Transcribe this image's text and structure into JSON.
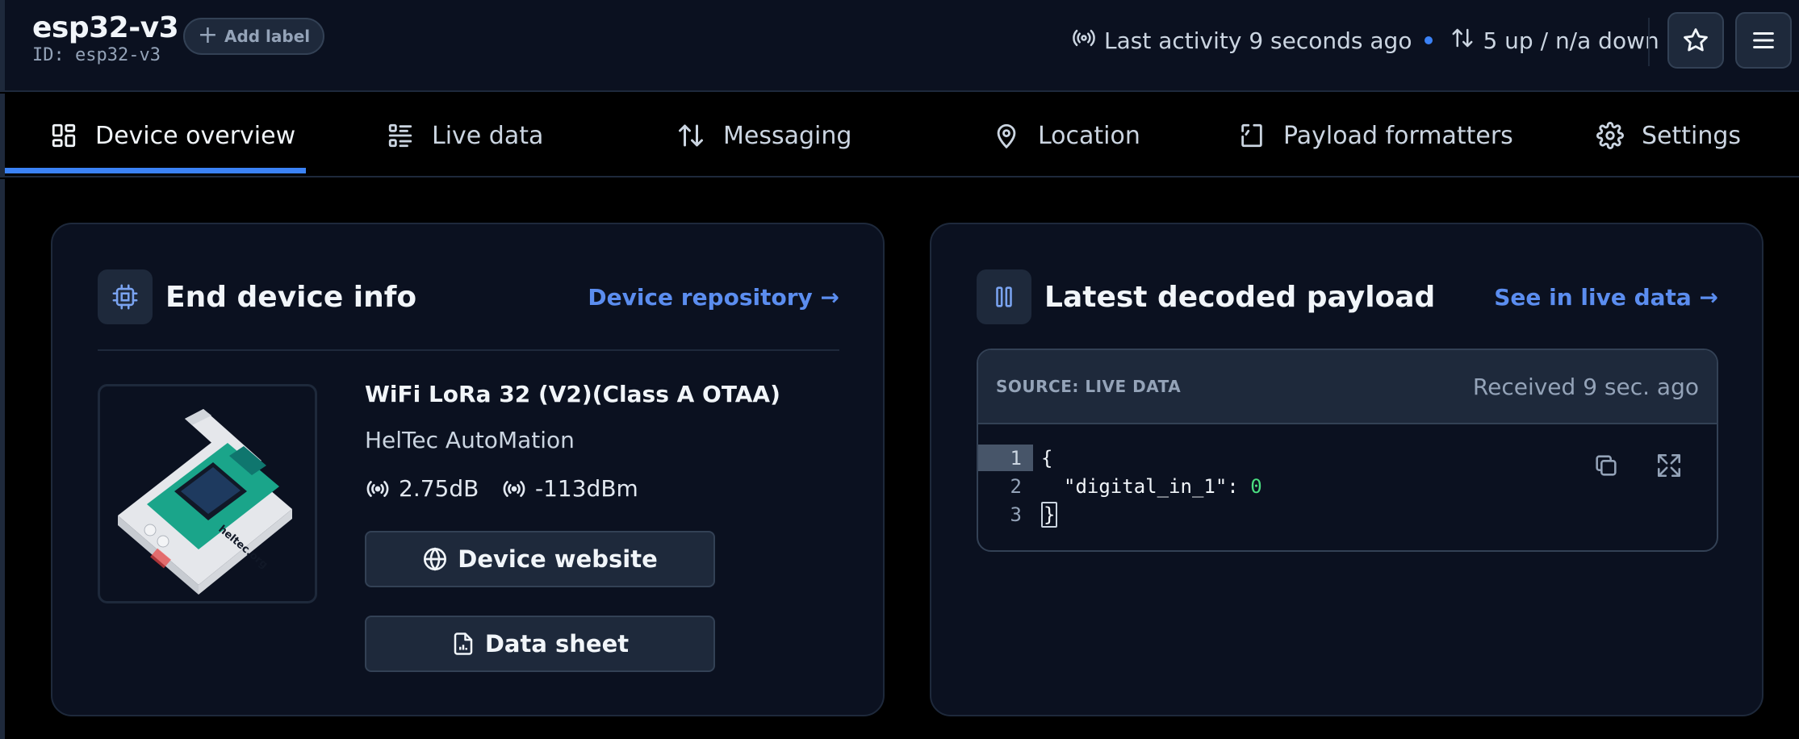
{
  "header": {
    "device_name": "esp32-v3",
    "device_id": "ID: esp32-v3",
    "add_label": "Add label",
    "last_activity": "Last activity 9 seconds ago",
    "traffic": "5 up / n/a down",
    "accent_color": "#3b82f6"
  },
  "tabs": [
    {
      "label": "Device overview",
      "icon": "grid-icon",
      "active": true
    },
    {
      "label": "Live data",
      "icon": "list-icon"
    },
    {
      "label": "Messaging",
      "icon": "arrows-up-down-icon"
    },
    {
      "label": "Location",
      "icon": "map-pin-icon"
    },
    {
      "label": "Payload formatters",
      "icon": "code-brackets-icon"
    },
    {
      "label": "Settings",
      "icon": "gear-icon"
    }
  ],
  "device_info": {
    "title": "End device info",
    "link": "Device repository →",
    "model": "WiFi LoRa 32 (V2)(Class A OTAA)",
    "vendor": "HelTec AutoMation",
    "snr": "2.75dB",
    "rssi": "-113dBm",
    "website_button": "Device website",
    "datasheet_button": "Data sheet",
    "image_text": "heltec.org"
  },
  "payload": {
    "title": "Latest decoded payload",
    "link": "See in live data →",
    "source": "SOURCE: LIVE DATA",
    "received": "Received 9 sec. ago",
    "line_numbers": [
      "1",
      "2",
      "3"
    ],
    "open_brace": "{",
    "key": "\"digital_in_1\": ",
    "value": "0",
    "close_brace": "}"
  }
}
